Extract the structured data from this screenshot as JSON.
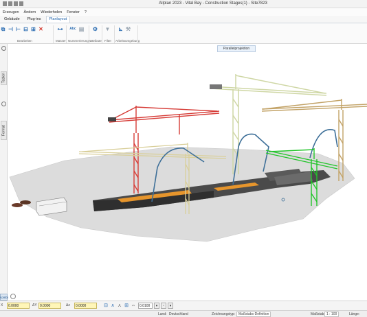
{
  "window": {
    "title": "Allplan 2023 - Vital Bay - Construction Stages(1) - Site7823"
  },
  "menu": [
    "Erzeugen",
    "Ändern",
    "Wiederholen",
    "Fenster",
    "?"
  ],
  "tabs": [
    "Gebäude",
    "Plug-ins",
    "Planlayout"
  ],
  "active_tab": "Planlayout",
  "ribbon_groups": [
    "Bearbeiten",
    "Massen",
    "Nummerierungen",
    "Attribute",
    "Filter",
    "Arbeitsumgebung"
  ],
  "tooltip": "Parallelprojektion",
  "side_panels": [
    "Tasten",
    "Format"
  ],
  "left_button": "Kombi",
  "coords": {
    "x_label": "X",
    "x_value": "0.0000",
    "y_label": "ΔY",
    "y_value": "0.0000",
    "z_label": "Δz",
    "z_value": "0.0000"
  },
  "scale_value": "0.0100",
  "status": {
    "land_label": "Land:",
    "land_value": "Deutschland",
    "type_label": "Zeichnungstyp:",
    "type_value": "Maßstabs-Definition",
    "scale_label": "Maßstab:",
    "scale_value": "1 : 100",
    "length_label": "Länge:"
  },
  "colors": {
    "crane_red": "#d63b36",
    "crane_green": "#22c52a",
    "crane_yellow": "#d9cf9a",
    "crane_tan": "#c2a266",
    "concrete_pump": "#3d6f98",
    "ground": "#dcdcdc",
    "building_dark": "#3e3e3e",
    "rebar_orange": "#e6952c"
  }
}
